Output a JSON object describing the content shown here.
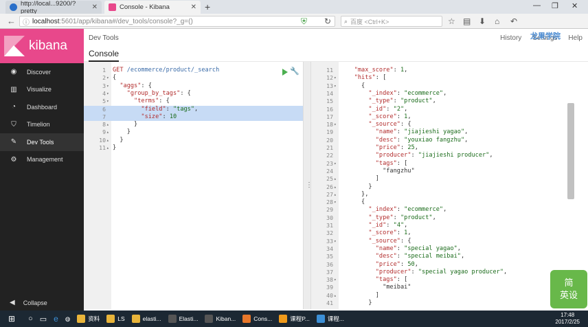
{
  "browser": {
    "tabs": [
      {
        "label": "http://local...9200/?pretty",
        "favicon_color": "#2a6fc9"
      },
      {
        "label": "Console - Kibana",
        "favicon_color": "#e8488b"
      }
    ],
    "url_host": "localhost",
    "url_path": ":5601/app/kibana#/dev_tools/console?_g=()",
    "search_placeholder": "百度 <Ctrl+K>"
  },
  "sidebar": {
    "brand": "kibana",
    "items": [
      {
        "label": "Discover",
        "icon": "compass-icon",
        "glyph": "◉"
      },
      {
        "label": "Visualize",
        "icon": "bar-chart-icon",
        "glyph": "▥"
      },
      {
        "label": "Dashboard",
        "icon": "dashboard-icon",
        "glyph": "◔"
      },
      {
        "label": "Timelion",
        "icon": "shield-icon",
        "glyph": "⛉"
      },
      {
        "label": "Dev Tools",
        "icon": "wrench-icon",
        "glyph": "✎"
      },
      {
        "label": "Management",
        "icon": "gear-icon",
        "glyph": "⚙"
      }
    ],
    "active_index": 4,
    "collapse_label": "Collapse"
  },
  "header": {
    "breadcrumb": "Dev Tools",
    "title": "Console",
    "links": [
      "History",
      "Settings",
      "Help"
    ]
  },
  "editor": {
    "method": "GET",
    "path": "/ecommerce/product/_search",
    "lines": [
      {
        "n": "1",
        "text": "",
        "fold": ""
      },
      {
        "n": "2",
        "text": "{",
        "fold": "▾"
      },
      {
        "n": "3",
        "text": "  \"aggs\": {",
        "fold": "▾"
      },
      {
        "n": "4",
        "text": "    \"group_by_tags\": {",
        "fold": "▾"
      },
      {
        "n": "5",
        "text": "      \"terms\": {",
        "fold": "▾"
      },
      {
        "n": "6",
        "text": "        \"field\": \"tags\",",
        "fold": ""
      },
      {
        "n": "7",
        "text": "        \"size\": 10",
        "fold": ""
      },
      {
        "n": "8",
        "text": "      }",
        "fold": "▴"
      },
      {
        "n": "9",
        "text": "    }",
        "fold": "▴"
      },
      {
        "n": "10",
        "text": "  }",
        "fold": "▴"
      },
      {
        "n": "11",
        "text": "}",
        "fold": "▴"
      }
    ]
  },
  "response": {
    "lines": [
      {
        "n": "11",
        "text": "    \"max_score\": 1,",
        "fold": ""
      },
      {
        "n": "12",
        "text": "    \"hits\": [",
        "fold": "▾"
      },
      {
        "n": "13",
        "text": "      {",
        "fold": "▾"
      },
      {
        "n": "14",
        "text": "        \"_index\": \"ecommerce\",",
        "fold": ""
      },
      {
        "n": "15",
        "text": "        \"_type\": \"product\",",
        "fold": ""
      },
      {
        "n": "16",
        "text": "        \"_id\": \"2\",",
        "fold": ""
      },
      {
        "n": "17",
        "text": "        \"_score\": 1,",
        "fold": ""
      },
      {
        "n": "18",
        "text": "        \"_source\": {",
        "fold": "▾"
      },
      {
        "n": "19",
        "text": "          \"name\": \"jiajieshi yagao\",",
        "fold": ""
      },
      {
        "n": "20",
        "text": "          \"desc\": \"youxiao fangzhu\",",
        "fold": ""
      },
      {
        "n": "21",
        "text": "          \"price\": 25,",
        "fold": ""
      },
      {
        "n": "22",
        "text": "          \"producer\": \"jiajieshi producer\",",
        "fold": ""
      },
      {
        "n": "23",
        "text": "          \"tags\": [",
        "fold": "▾"
      },
      {
        "n": "24",
        "text": "            \"fangzhu\"",
        "fold": ""
      },
      {
        "n": "25",
        "text": "          ]",
        "fold": "▴"
      },
      {
        "n": "26",
        "text": "        }",
        "fold": "▴"
      },
      {
        "n": "27",
        "text": "      },",
        "fold": "▴"
      },
      {
        "n": "28",
        "text": "      {",
        "fold": "▾"
      },
      {
        "n": "29",
        "text": "        \"_index\": \"ecommerce\",",
        "fold": ""
      },
      {
        "n": "30",
        "text": "        \"_type\": \"product\",",
        "fold": ""
      },
      {
        "n": "31",
        "text": "        \"_id\": \"4\",",
        "fold": ""
      },
      {
        "n": "32",
        "text": "        \"_score\": 1,",
        "fold": ""
      },
      {
        "n": "33",
        "text": "        \"_source\": {",
        "fold": "▾"
      },
      {
        "n": "34",
        "text": "          \"name\": \"special yagao\",",
        "fold": ""
      },
      {
        "n": "35",
        "text": "          \"desc\": \"special meibai\",",
        "fold": ""
      },
      {
        "n": "36",
        "text": "          \"price\": 50,",
        "fold": ""
      },
      {
        "n": "37",
        "text": "          \"producer\": \"special yagao producer\",",
        "fold": ""
      },
      {
        "n": "38",
        "text": "          \"tags\": [",
        "fold": "▾"
      },
      {
        "n": "39",
        "text": "            \"meibai\"",
        "fold": ""
      },
      {
        "n": "40",
        "text": "          ]",
        "fold": "▴"
      },
      {
        "n": "41",
        "text": "        }",
        "fold": ""
      }
    ]
  },
  "watermark": "龙果学院",
  "badge": "简\n英设",
  "taskbar": {
    "items": [
      {
        "label": "资料",
        "color": "#e8b43a"
      },
      {
        "label": "LS",
        "color": "#e8b43a"
      },
      {
        "label": "elasti...",
        "color": "#e8b43a"
      },
      {
        "label": "Elasti...",
        "color": "#555"
      },
      {
        "label": "Kiban...",
        "color": "#555"
      },
      {
        "label": "Cons...",
        "color": "#e8772a"
      },
      {
        "label": "课程P...",
        "color": "#f09a1a"
      },
      {
        "label": "课程...",
        "color": "#3c8fd6"
      }
    ],
    "time": "17:48",
    "date": "2017/2/25"
  },
  "colors": {
    "kibana_pink": "#e8488b",
    "sidebar_bg": "#222222",
    "selection": "#c7dbf5"
  }
}
